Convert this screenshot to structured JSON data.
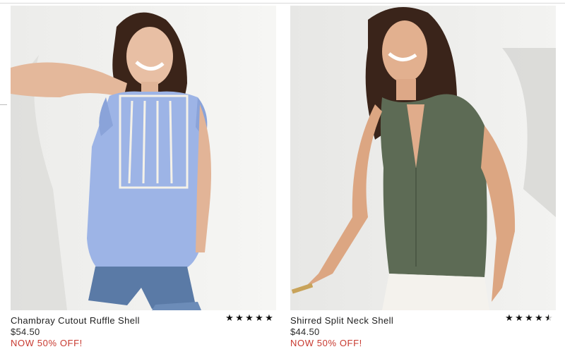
{
  "products": [
    {
      "name": "Chambray Cutout Ruffle Shell",
      "price": "$54.50",
      "promo": "NOW 50% OFF!",
      "rating": 5,
      "image_alt": "Model wearing chambray cutout ruffle shell"
    },
    {
      "name": "Shirred Split Neck Shell",
      "price": "$44.50",
      "promo": "NOW 50% OFF!",
      "rating": 4.5,
      "image_alt": "Model wearing shirred split neck shell"
    }
  ],
  "icons": {
    "star_full": "★",
    "star_half": "★"
  },
  "colors": {
    "promo": "#c8392f",
    "text": "#222222",
    "chambray": "#9db4e6",
    "olive": "#5d6b55"
  }
}
